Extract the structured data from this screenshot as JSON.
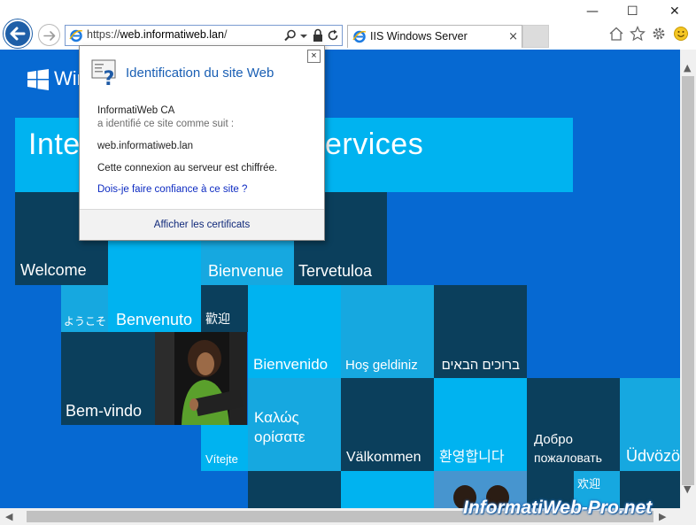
{
  "browser": {
    "url_prefix": "https://",
    "url_host": "web.informatiweb.lan",
    "url_suffix": "/",
    "tab_title": "IIS Windows Server",
    "tab_close": "×",
    "minimize": "—",
    "maximize": "☐",
    "close": "✕"
  },
  "page": {
    "brand_text": "Win",
    "title_left": "Inte",
    "title_right": "ervices",
    "tiles": {
      "welcome": "Welcome",
      "bienvenue": "Bienvenue",
      "tervetuloa": "Tervetuloa",
      "yokoso": "ようこそ",
      "benvenuto": "Benvenuto",
      "kangying": "歡迎",
      "bienvenido": "Bienvenido",
      "hosgeldiniz": "Hoş geldiniz",
      "hebrew": "ברוכים הבאים",
      "bemvindo": "Bem-vindo",
      "vitejte": "Vítejte",
      "kalos_1": "Καλώς",
      "kalos_2": "ορίσατε",
      "valkommen": "Välkommen",
      "korean": "환영합니다",
      "dobro_1": "Добро",
      "dobro_2": "пожаловать",
      "udvozol": "Üdvözö",
      "bottom_cjk": "欢迎"
    }
  },
  "popup": {
    "title": "Identification du site Web",
    "close": "×",
    "issuer": "InformatiWeb CA",
    "issuer_sub": "a identifié ce site comme suit :",
    "site": "web.informatiweb.lan",
    "encrypted": "Cette connexion au serveur est chiffrée.",
    "trust_link": "Dois-je faire confiance à ce site ?",
    "view_certs": "Afficher les certificats"
  },
  "watermark": "InformatiWeb-Pro.net",
  "colors": {
    "page_bg": "#0669d2",
    "tile_dark": "#0b3f5c",
    "tile_cyan": "#00b3f0",
    "tile_light": "#16a8e0",
    "link_blue": "#0d2bc2"
  }
}
